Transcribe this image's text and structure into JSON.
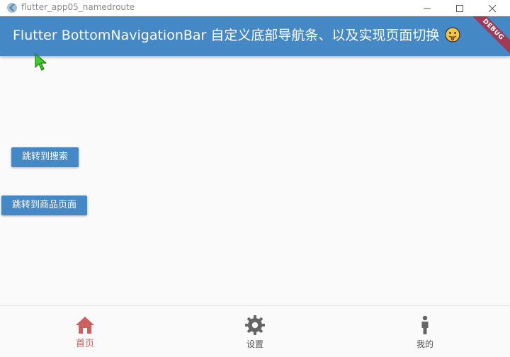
{
  "window": {
    "title": "flutter_app05_namedroute"
  },
  "appbar": {
    "title": "Flutter BottomNavigationBar 自定义底部导航条、以及实现页面切换",
    "emoji_icon": "tongue-face-icon",
    "background": "#4588c6",
    "debug_label": "DEBUG"
  },
  "buttons": {
    "search_label": "跳转到搜索",
    "goods_label": "跳转到商品页面"
  },
  "bottom_nav": {
    "items": [
      {
        "label": "首页",
        "icon": "home-icon",
        "selected": true,
        "color": "#cc5f5f"
      },
      {
        "label": "设置",
        "icon": "gear-icon",
        "selected": false,
        "color": "#666666"
      },
      {
        "label": "我的",
        "icon": "person-icon",
        "selected": false,
        "color": "#666666"
      }
    ]
  }
}
